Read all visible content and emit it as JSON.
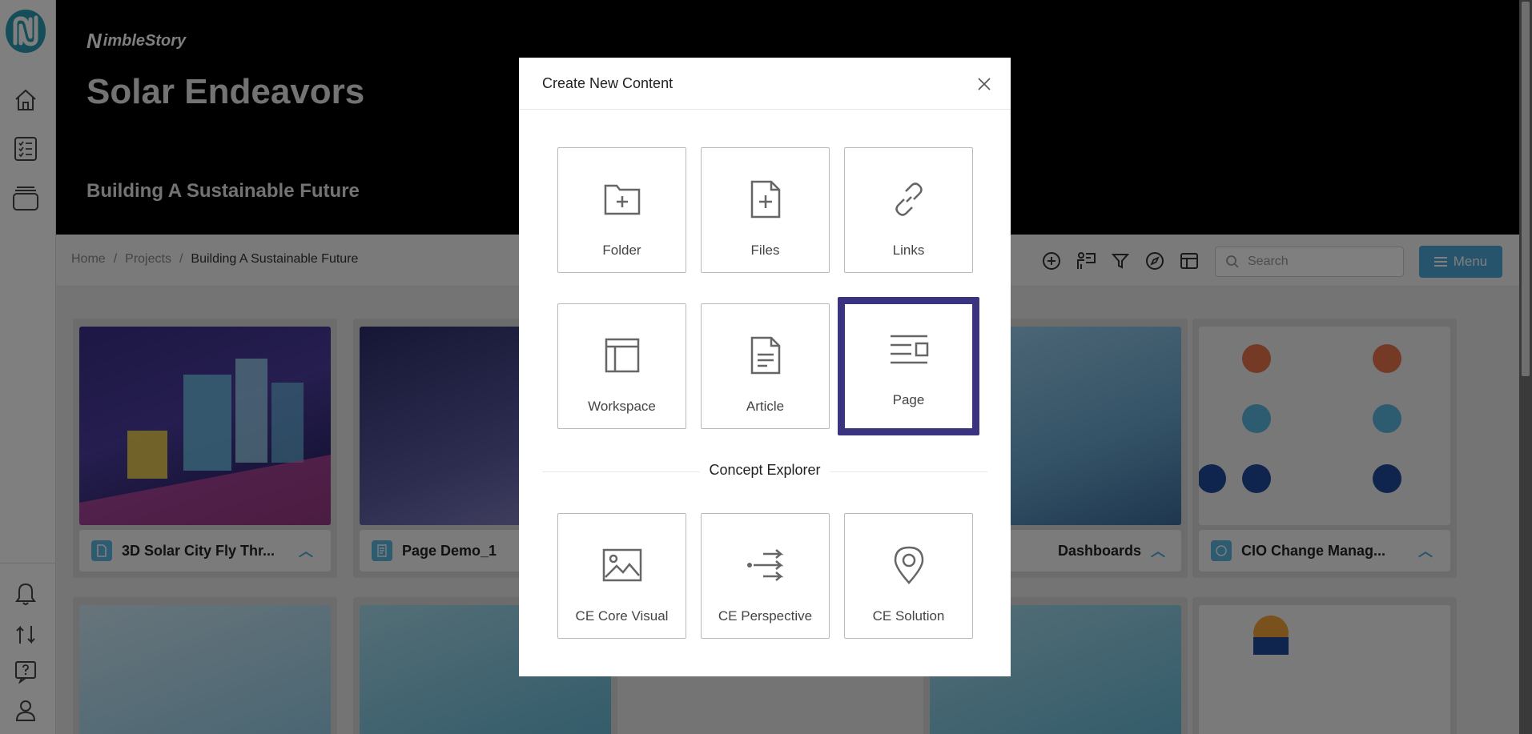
{
  "app": {
    "brand": "imbleStory",
    "brand_initial": "N"
  },
  "header": {
    "title": "Solar Endeavors",
    "subtitle": "Building A Sustainable Future"
  },
  "breadcrumb": {
    "items": [
      "Home",
      "Projects",
      "Building A Sustainable Future"
    ],
    "separator": "/"
  },
  "toolbar": {
    "search_placeholder": "Search",
    "menu_label": "Menu"
  },
  "cards": [
    {
      "title": "3D Solar City Fly Thr..."
    },
    {
      "title": "Page Demo_1"
    },
    {
      "title": "Dashboards"
    },
    {
      "title": "CIO Change Manag..."
    }
  ],
  "modal": {
    "title": "Create New Content",
    "tiles": [
      {
        "label": "Folder",
        "icon": "folder-plus-icon"
      },
      {
        "label": "Files",
        "icon": "file-plus-icon"
      },
      {
        "label": "Links",
        "icon": "link-icon"
      },
      {
        "label": "Workspace",
        "icon": "workspace-icon"
      },
      {
        "label": "Article",
        "icon": "article-icon"
      },
      {
        "label": "Page",
        "icon": "page-icon",
        "selected": true
      }
    ],
    "section_title": "Concept Explorer",
    "ce_tiles": [
      {
        "label": "CE Core Visual",
        "icon": "image-icon"
      },
      {
        "label": "CE Perspective",
        "icon": "perspective-icon"
      },
      {
        "label": "CE Solution",
        "icon": "map-pin-icon"
      }
    ]
  },
  "colors": {
    "accent": "#4aa9d9",
    "selected_border": "#3a3380",
    "banner": "#000000"
  }
}
